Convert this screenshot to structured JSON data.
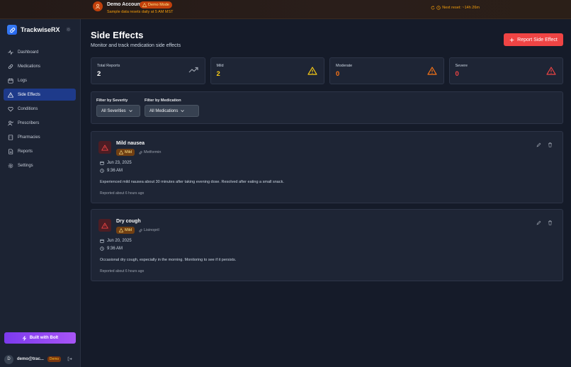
{
  "banner": {
    "title": "Demo Account",
    "badge": "Demo Mode",
    "subtitle": "Sample data resets daily at 5 AM MST",
    "next_reset": "Next reset: ~14h 26m"
  },
  "sidebar": {
    "brand": "TrackwiseRX",
    "items": [
      {
        "label": "Dashboard",
        "icon": "activity-icon"
      },
      {
        "label": "Medications",
        "icon": "pill-icon"
      },
      {
        "label": "Logs",
        "icon": "calendar-icon"
      },
      {
        "label": "Side Effects",
        "icon": "warning-icon",
        "active": true
      },
      {
        "label": "Conditions",
        "icon": "heart-icon"
      },
      {
        "label": "Prescribers",
        "icon": "user-icon"
      },
      {
        "label": "Pharmacies",
        "icon": "building-icon"
      },
      {
        "label": "Reports",
        "icon": "file-icon"
      },
      {
        "label": "Settings",
        "icon": "gear-icon"
      }
    ],
    "bolt_button": "Built with Bolt",
    "user": {
      "initial": "D",
      "email": "demo@trac...",
      "badge": "Demo"
    }
  },
  "main": {
    "title": "Side Effects",
    "subtitle": "Monitor and track medication side effects",
    "report_button": "Report Side Effect",
    "stats": [
      {
        "label": "Total Reports",
        "value": "2",
        "color": "#ffffff",
        "icon": "trending-up-icon"
      },
      {
        "label": "Mild",
        "value": "2",
        "color": "#facc15",
        "icon": "warning-icon"
      },
      {
        "label": "Moderate",
        "value": "0",
        "color": "#f97316",
        "icon": "warning-icon"
      },
      {
        "label": "Severe",
        "value": "0",
        "color": "#ef4444",
        "icon": "warning-icon"
      }
    ],
    "filters": {
      "severity_label": "Filter by Severity",
      "severity_value": "All Severities",
      "medication_label": "Filter by Medication",
      "medication_value": "All Medications"
    },
    "reports": [
      {
        "title": "Mild nausea",
        "severity": "Mild",
        "medication": "Metformin",
        "date": "Jun 23, 2025",
        "time": "9:36 AM",
        "description": "Experienced mild nausea about 30 minutes after taking evening dose. Resolved after eating a small snack.",
        "reported": "Reported about 6 hours ago"
      },
      {
        "title": "Dry cough",
        "severity": "Mild",
        "medication": "Lisinopril",
        "date": "Jun 20, 2025",
        "time": "9:36 AM",
        "description": "Occasional dry cough, especially in the morning. Monitoring to see if it persists.",
        "reported": "Reported about 6 hours ago"
      }
    ]
  }
}
